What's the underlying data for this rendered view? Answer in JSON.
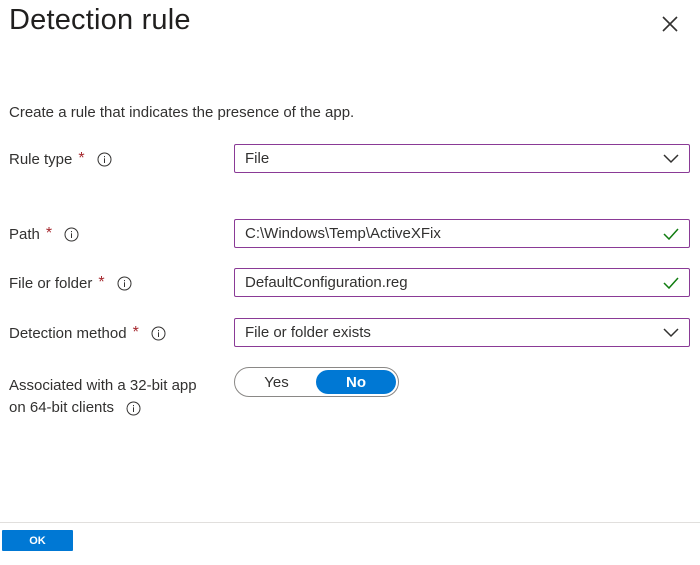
{
  "panel": {
    "title": "Detection rule",
    "description": "Create a rule that indicates the presence of the app."
  },
  "fields": {
    "rule_type": {
      "label": "Rule type",
      "required": "*",
      "value": "File"
    },
    "path": {
      "label": "Path",
      "required": "*",
      "value": "C:\\Windows\\Temp\\ActiveXFix"
    },
    "file_or_folder": {
      "label": "File or folder",
      "required": "*",
      "value": "DefaultConfiguration.reg"
    },
    "detection_method": {
      "label": "Detection method",
      "required": "*",
      "value": "File or folder exists"
    },
    "associated_32bit": {
      "label_line1": "Associated with a 32-bit app",
      "label_line2": "on 64-bit clients",
      "options": [
        "Yes",
        "No"
      ],
      "selected": "No"
    }
  },
  "footer": {
    "ok_label": "OK"
  },
  "colors": {
    "accent": "#0078d4",
    "input_border": "#8a3a96",
    "required": "#a4262c",
    "valid_check": "#107c10"
  },
  "icons": {
    "close": "close-icon",
    "info": "info-icon",
    "dropdown": "chevron-down-icon",
    "valid": "checkmark-icon"
  }
}
